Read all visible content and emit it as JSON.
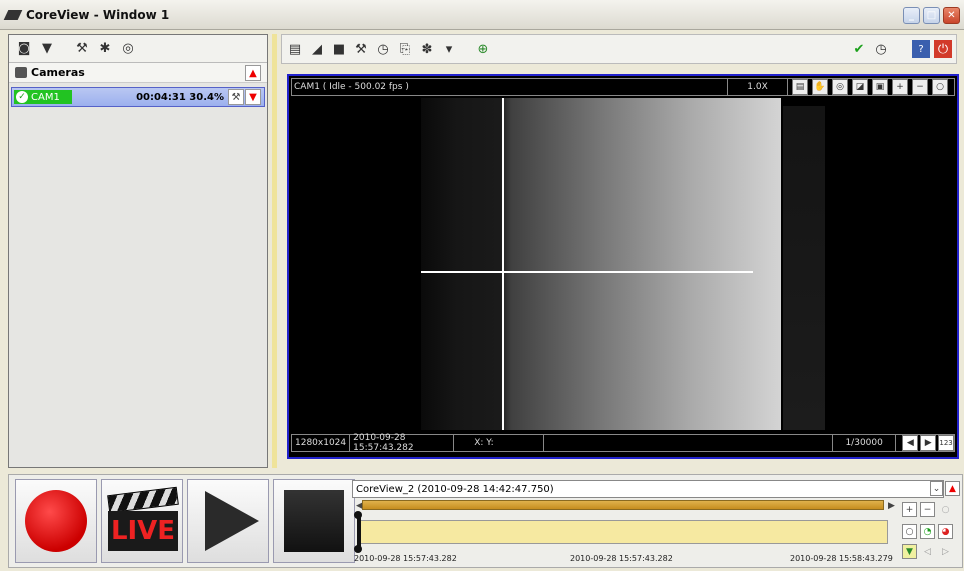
{
  "window": {
    "title": "CoreView - Window 1"
  },
  "cameras": {
    "header": "Cameras",
    "items": [
      {
        "name": "CAM1",
        "time": "00:04:31",
        "percent": "30.4%"
      }
    ]
  },
  "viewer": {
    "title": "CAM1  ( Idle - 500.02 fps )",
    "zoom": "1.0X",
    "resolution": "1280x1024",
    "timestamp": "2010-09-28 15:57:43.282",
    "coords": "X:  Y:",
    "shutter": "1/30000",
    "frame_btn": "123"
  },
  "timeline": {
    "session": "CoreView_2  (2010-09-28 14:42:47.750)",
    "start_time": "2010-09-28 15:57:43.282",
    "current_time": "2010-09-28 15:57:43.282",
    "end_time": "2010-09-28 15:58:43.279"
  },
  "playback": {
    "live_label": "LIVE"
  },
  "colors": {
    "accent_blue": "#2222cc",
    "cam_green": "#22c322",
    "record_red": "#cc0000"
  }
}
